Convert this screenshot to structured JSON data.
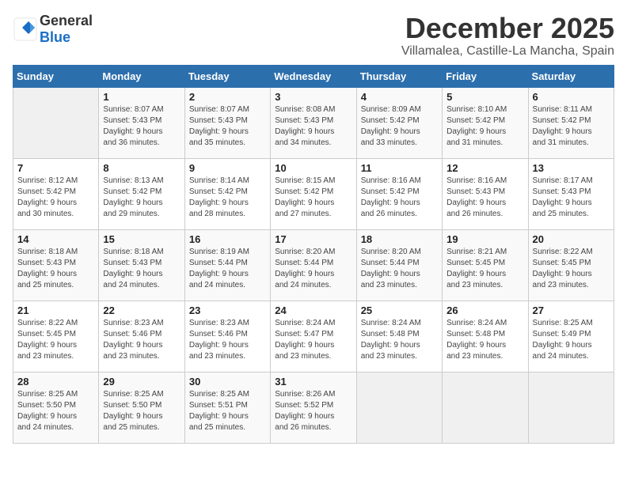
{
  "logo": {
    "general": "General",
    "blue": "Blue"
  },
  "title": "December 2025",
  "location": "Villamalea, Castille-La Mancha, Spain",
  "days_of_week": [
    "Sunday",
    "Monday",
    "Tuesday",
    "Wednesday",
    "Thursday",
    "Friday",
    "Saturday"
  ],
  "weeks": [
    [
      {
        "day": "",
        "info": ""
      },
      {
        "day": "1",
        "info": "Sunrise: 8:07 AM\nSunset: 5:43 PM\nDaylight: 9 hours\nand 36 minutes."
      },
      {
        "day": "2",
        "info": "Sunrise: 8:07 AM\nSunset: 5:43 PM\nDaylight: 9 hours\nand 35 minutes."
      },
      {
        "day": "3",
        "info": "Sunrise: 8:08 AM\nSunset: 5:43 PM\nDaylight: 9 hours\nand 34 minutes."
      },
      {
        "day": "4",
        "info": "Sunrise: 8:09 AM\nSunset: 5:42 PM\nDaylight: 9 hours\nand 33 minutes."
      },
      {
        "day": "5",
        "info": "Sunrise: 8:10 AM\nSunset: 5:42 PM\nDaylight: 9 hours\nand 31 minutes."
      },
      {
        "day": "6",
        "info": "Sunrise: 8:11 AM\nSunset: 5:42 PM\nDaylight: 9 hours\nand 31 minutes."
      }
    ],
    [
      {
        "day": "7",
        "info": "Sunrise: 8:12 AM\nSunset: 5:42 PM\nDaylight: 9 hours\nand 30 minutes."
      },
      {
        "day": "8",
        "info": "Sunrise: 8:13 AM\nSunset: 5:42 PM\nDaylight: 9 hours\nand 29 minutes."
      },
      {
        "day": "9",
        "info": "Sunrise: 8:14 AM\nSunset: 5:42 PM\nDaylight: 9 hours\nand 28 minutes."
      },
      {
        "day": "10",
        "info": "Sunrise: 8:15 AM\nSunset: 5:42 PM\nDaylight: 9 hours\nand 27 minutes."
      },
      {
        "day": "11",
        "info": "Sunrise: 8:16 AM\nSunset: 5:42 PM\nDaylight: 9 hours\nand 26 minutes."
      },
      {
        "day": "12",
        "info": "Sunrise: 8:16 AM\nSunset: 5:43 PM\nDaylight: 9 hours\nand 26 minutes."
      },
      {
        "day": "13",
        "info": "Sunrise: 8:17 AM\nSunset: 5:43 PM\nDaylight: 9 hours\nand 25 minutes."
      }
    ],
    [
      {
        "day": "14",
        "info": "Sunrise: 8:18 AM\nSunset: 5:43 PM\nDaylight: 9 hours\nand 25 minutes."
      },
      {
        "day": "15",
        "info": "Sunrise: 8:18 AM\nSunset: 5:43 PM\nDaylight: 9 hours\nand 24 minutes."
      },
      {
        "day": "16",
        "info": "Sunrise: 8:19 AM\nSunset: 5:44 PM\nDaylight: 9 hours\nand 24 minutes."
      },
      {
        "day": "17",
        "info": "Sunrise: 8:20 AM\nSunset: 5:44 PM\nDaylight: 9 hours\nand 24 minutes."
      },
      {
        "day": "18",
        "info": "Sunrise: 8:20 AM\nSunset: 5:44 PM\nDaylight: 9 hours\nand 23 minutes."
      },
      {
        "day": "19",
        "info": "Sunrise: 8:21 AM\nSunset: 5:45 PM\nDaylight: 9 hours\nand 23 minutes."
      },
      {
        "day": "20",
        "info": "Sunrise: 8:22 AM\nSunset: 5:45 PM\nDaylight: 9 hours\nand 23 minutes."
      }
    ],
    [
      {
        "day": "21",
        "info": "Sunrise: 8:22 AM\nSunset: 5:45 PM\nDaylight: 9 hours\nand 23 minutes."
      },
      {
        "day": "22",
        "info": "Sunrise: 8:23 AM\nSunset: 5:46 PM\nDaylight: 9 hours\nand 23 minutes."
      },
      {
        "day": "23",
        "info": "Sunrise: 8:23 AM\nSunset: 5:46 PM\nDaylight: 9 hours\nand 23 minutes."
      },
      {
        "day": "24",
        "info": "Sunrise: 8:24 AM\nSunset: 5:47 PM\nDaylight: 9 hours\nand 23 minutes."
      },
      {
        "day": "25",
        "info": "Sunrise: 8:24 AM\nSunset: 5:48 PM\nDaylight: 9 hours\nand 23 minutes."
      },
      {
        "day": "26",
        "info": "Sunrise: 8:24 AM\nSunset: 5:48 PM\nDaylight: 9 hours\nand 23 minutes."
      },
      {
        "day": "27",
        "info": "Sunrise: 8:25 AM\nSunset: 5:49 PM\nDaylight: 9 hours\nand 24 minutes."
      }
    ],
    [
      {
        "day": "28",
        "info": "Sunrise: 8:25 AM\nSunset: 5:50 PM\nDaylight: 9 hours\nand 24 minutes."
      },
      {
        "day": "29",
        "info": "Sunrise: 8:25 AM\nSunset: 5:50 PM\nDaylight: 9 hours\nand 25 minutes."
      },
      {
        "day": "30",
        "info": "Sunrise: 8:25 AM\nSunset: 5:51 PM\nDaylight: 9 hours\nand 25 minutes."
      },
      {
        "day": "31",
        "info": "Sunrise: 8:26 AM\nSunset: 5:52 PM\nDaylight: 9 hours\nand 26 minutes."
      },
      {
        "day": "",
        "info": ""
      },
      {
        "day": "",
        "info": ""
      },
      {
        "day": "",
        "info": ""
      }
    ]
  ]
}
